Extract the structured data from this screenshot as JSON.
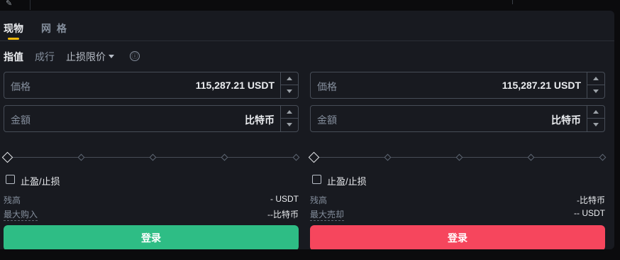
{
  "tabs": {
    "spot": "现物",
    "grid": "网 格"
  },
  "order_types": {
    "limit": "指值",
    "market": "成行",
    "stop_limit": "止损限价"
  },
  "info_icon": "ⓘ",
  "buy": {
    "price_label": "価格",
    "price_value": "115,287.21  USDT",
    "amount_label": "金額",
    "amount_unit": "比特币",
    "tpsl_label": "止盈/止损",
    "available_label": "残高",
    "available_value": "- USDT",
    "max_label": "最大购入",
    "max_value": "--比特币",
    "button_label": "登录",
    "button_color": "#2ebd85"
  },
  "sell": {
    "price_label": "価格",
    "price_value": "115,287.21  USDT",
    "amount_label": "金額",
    "amount_unit": "比特币",
    "tpsl_label": "止盈/止损",
    "available_label": "残高",
    "available_value": "-比特币",
    "max_label": "最大売却",
    "max_value": "-- USDT",
    "button_label": "登录",
    "button_color": "#f6465d"
  },
  "accent_color": "#f0b90b",
  "icons": {
    "stepper_up": "chevron-up-icon",
    "stepper_down": "chevron-down-icon",
    "pencil": "pencil-icon"
  }
}
